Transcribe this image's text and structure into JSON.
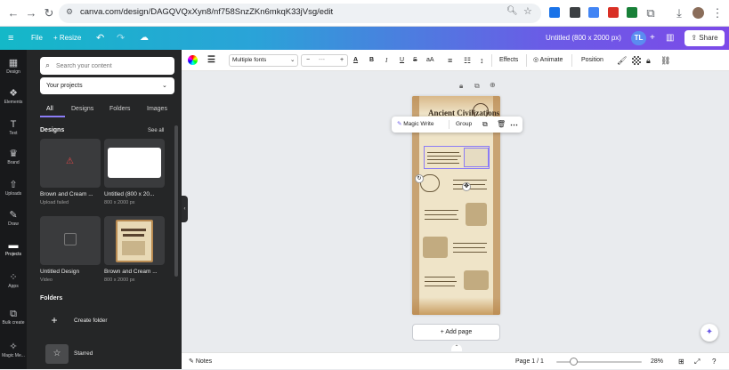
{
  "browser": {
    "url": "canva.com/design/DAGQVQxXyn8/nf758SnzZKn6mkqK33jVsg/edit"
  },
  "topbar": {
    "file_label": "File",
    "resize_label": "Resize",
    "doc_title": "Untitled (800 x 2000 px)",
    "user_initials": "TL",
    "share_label": "Share"
  },
  "rail": {
    "items": [
      {
        "label": "Design"
      },
      {
        "label": "Elements"
      },
      {
        "label": "Text"
      },
      {
        "label": "Brand"
      },
      {
        "label": "Uploads"
      },
      {
        "label": "Draw"
      },
      {
        "label": "Projects"
      },
      {
        "label": "Apps"
      },
      {
        "label": "Bulk create"
      },
      {
        "label": "Magic Me..."
      }
    ]
  },
  "panel": {
    "search_placeholder": "Search your content",
    "projects_select": "Your projects",
    "tabs": [
      "All",
      "Designs",
      "Folders",
      "Images"
    ],
    "designs_heading": "Designs",
    "see_all": "See all",
    "designs": [
      {
        "title": "Brown and Cream ...",
        "sub": "Upload failed"
      },
      {
        "title": "Untitled (800 x 20...",
        "sub": "800 x 2000 px"
      },
      {
        "title": "Untitled Design",
        "sub": "Video"
      },
      {
        "title": "Brown and Cream ...",
        "sub": "800 x 2000 px"
      }
    ],
    "folders_heading": "Folders",
    "create_folder": "Create folder",
    "starred": "Starred"
  },
  "toolbar": {
    "font": "Multiple fonts",
    "size_minus": "−",
    "size_value": "---",
    "size_plus": "+",
    "case_label": "aA",
    "effects": "Effects",
    "animate": "Animate",
    "position": "Position"
  },
  "context_menu": {
    "magic_write": "Magic Write",
    "group": "Group"
  },
  "canvas": {
    "add_page": "+ Add page",
    "page_heading": "Ancient Civilizations"
  },
  "bottombar": {
    "notes": "Notes",
    "page_indicator": "Page 1 / 1",
    "zoom": "28%",
    "zoom_fraction": 0.2
  },
  "colors": {
    "accent": "#8b7cf6",
    "panel_bg": "#252627",
    "rail_bg": "#18191b"
  }
}
